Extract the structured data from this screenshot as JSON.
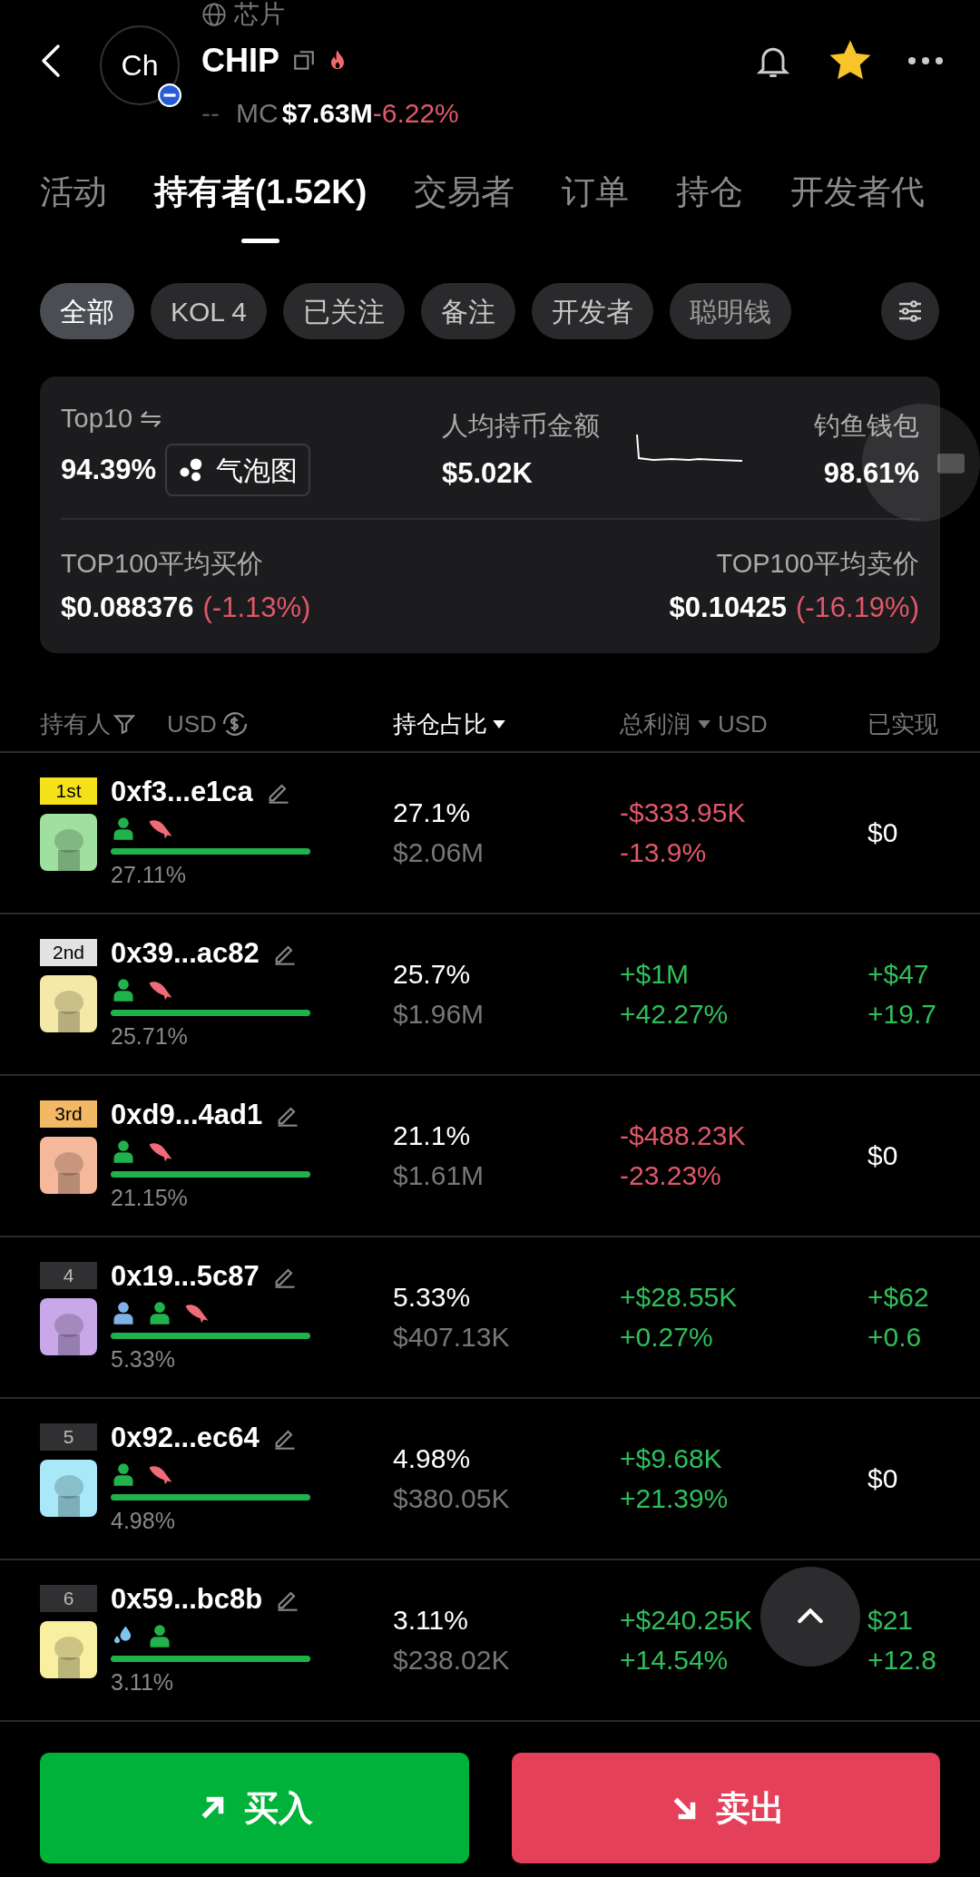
{
  "header": {
    "category": "芯片",
    "avatar_text": "Ch",
    "symbol": "CHIP",
    "mc_prefix": "--",
    "mc_label": "MC",
    "market_cap": "$7.63M",
    "change": "-6.22%",
    "favorited": true
  },
  "tabs": [
    {
      "label": "活动",
      "selected": false
    },
    {
      "label": "持有者(1.52K)",
      "selected": true
    },
    {
      "label": "交易者",
      "selected": false
    },
    {
      "label": "订单",
      "selected": false
    },
    {
      "label": "持仓",
      "selected": false
    },
    {
      "label": "开发者代",
      "selected": false
    }
  ],
  "filters": [
    {
      "label": "全部",
      "selected": true
    },
    {
      "label": "KOL 4",
      "selected": false
    },
    {
      "label": "已关注",
      "selected": false
    },
    {
      "label": "备注",
      "selected": false
    },
    {
      "label": "开发者",
      "selected": false
    },
    {
      "label": "聪明钱",
      "selected": false
    }
  ],
  "summary": {
    "top10_label": "Top10 ⇋",
    "top10": "94.39%",
    "bubble_button": "气泡图",
    "avg_label": "人均持币金额",
    "avg": "$5.02K",
    "phishing_label": "钓鱼钱包",
    "phishing": "98.61%",
    "buy_label": "TOP100平均买价",
    "buy_price": "$0.088376",
    "buy_change": "(-1.13%)",
    "sell_label": "TOP100平均卖价",
    "sell_price": "$0.10425",
    "sell_change": "(-16.19%)"
  },
  "columns": {
    "holder": "持有人",
    "currency": "USD",
    "share": "持仓占比",
    "profit": "总利润",
    "profit_currency": "USD",
    "realized": "已实现"
  },
  "rows": [
    {
      "rank": {
        "label": "1st",
        "color": "#f5e11a"
      },
      "address": "0xf3...e1ca",
      "tags": [
        {
          "kind": "user"
        },
        {
          "kind": "fish"
        }
      ],
      "share_pct": "27.11%",
      "holding_pct": "27.1%",
      "holding_value": "$2.06M",
      "profit": {
        "kind": "loss",
        "value": "-$333.95K",
        "percent": "-13.9%"
      },
      "realized": {
        "kind": "flat",
        "values": [
          "$0"
        ]
      }
    },
    {
      "rank": {
        "label": "2nd",
        "color": "#e2e2e2"
      },
      "address": "0x39...ac82",
      "tags": [
        {
          "kind": "user"
        },
        {
          "kind": "fish"
        }
      ],
      "share_pct": "25.71%",
      "holding_pct": "25.7%",
      "holding_value": "$1.96M",
      "profit": {
        "kind": "gain",
        "value": "+$1M",
        "percent": "+42.27%"
      },
      "realized": {
        "kind": "gain",
        "values": [
          "+$47",
          "+19.7"
        ]
      }
    },
    {
      "rank": {
        "label": "3rd",
        "color": "#f2b864"
      },
      "address": "0xd9...4ad1",
      "tags": [
        {
          "kind": "user"
        },
        {
          "kind": "fish"
        }
      ],
      "share_pct": "21.15%",
      "holding_pct": "21.1%",
      "holding_value": "$1.61M",
      "profit": {
        "kind": "loss",
        "value": "-$488.23K",
        "percent": "-23.23%"
      },
      "realized": {
        "kind": "flat",
        "values": [
          "$0"
        ]
      }
    },
    {
      "rank": {
        "label": "4",
        "color": "#303032"
      },
      "address": "0x19...5c87",
      "tags": [
        {
          "kind": "user_alt"
        },
        {
          "kind": "user"
        },
        {
          "kind": "fish"
        }
      ],
      "share_pct": "5.33%",
      "holding_pct": "5.33%",
      "holding_value": "$407.13K",
      "profit": {
        "kind": "gain",
        "value": "+$28.55K",
        "percent": "+0.27%"
      },
      "realized": {
        "kind": "gain",
        "values": [
          "+$62",
          "+0.6"
        ]
      }
    },
    {
      "rank": {
        "label": "5",
        "color": "#303032"
      },
      "address": "0x92...ec64",
      "tags": [
        {
          "kind": "user"
        },
        {
          "kind": "fish"
        }
      ],
      "share_pct": "4.98%",
      "holding_pct": "4.98%",
      "holding_value": "$380.05K",
      "profit": {
        "kind": "gain",
        "value": "+$9.68K",
        "percent": "+21.39%"
      },
      "realized": {
        "kind": "flat",
        "values": [
          "$0"
        ]
      }
    },
    {
      "rank": {
        "label": "6",
        "color": "#303032"
      },
      "address": "0x59...bc8b",
      "tags": [
        {
          "kind": "splash"
        },
        {
          "kind": "user"
        }
      ],
      "share_pct": "3.11%",
      "holding_pct": "3.11%",
      "holding_value": "$238.02K",
      "profit": {
        "kind": "gain",
        "value": "+$240.25K",
        "percent": "+14.54%"
      },
      "realized": {
        "kind": "gain",
        "values": [
          "$21",
          "+12.8"
        ]
      }
    }
  ],
  "buttons": [
    {
      "label": "买入",
      "kind": "buy"
    },
    {
      "label": "卖出",
      "kind": "sell"
    }
  ]
}
